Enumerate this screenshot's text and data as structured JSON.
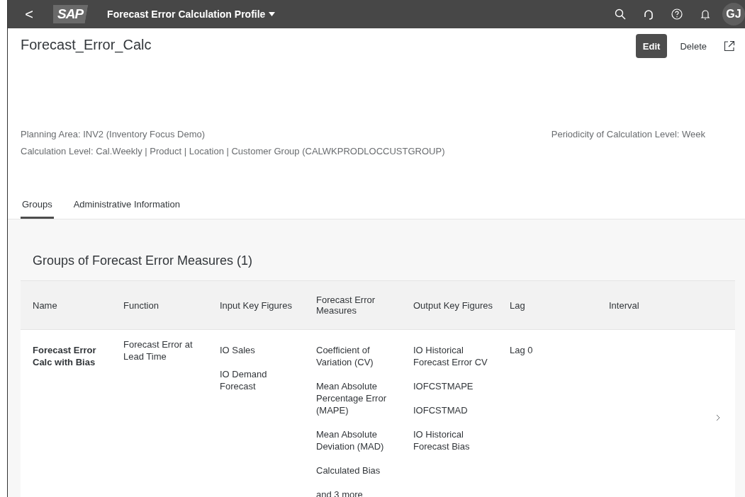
{
  "shell": {
    "back": "<",
    "logo": "SAP",
    "title": "Forecast Error Calculation Profile",
    "avatar": "GJ"
  },
  "header": {
    "title": "Forecast_Error_Calc",
    "actions": [
      {
        "label": "Edit",
        "kind": "primary"
      },
      {
        "label": "Delete",
        "kind": "plain"
      }
    ],
    "attributes": [
      "Planning Area: INV2 (Inventory Focus Demo)",
      "Calculation Level: Cal.Weekly | Product | Location | Customer Group (CALWKPRODLOCCUSTGROUP)"
    ],
    "side_attribute": "Periodicity of Calculation Level: Week"
  },
  "tabs": [
    {
      "label": "Groups",
      "selected": true
    },
    {
      "label": "Administrative Information",
      "selected": false
    }
  ],
  "section": {
    "title": "Groups of Forecast Error Measures (1)",
    "table": {
      "columns": [
        "Name",
        "Function",
        "Input Key Figures",
        "Forecast Error Measures",
        "Output Key Figures",
        "Lag",
        "Interval"
      ],
      "rows": [
        {
          "cells": [
            [
              "Forecast Error Calc with Bias"
            ],
            [
              "Forecast Error at Lead Time"
            ],
            [
              "IO Sales",
              "IO Demand Forecast"
            ],
            [
              "Coefficient of Variation (CV)",
              "Mean Absolute Percentage Error (MAPE)",
              "Mean Absolute Deviation (MAD)",
              "Calculated Bias",
              "and 3 more"
            ],
            [
              "IO Historical Forecast Error CV",
              "IOFCSTMAPE",
              "IOFCSTMAD",
              "IO Historical Forecast Bias"
            ],
            [
              "Lag 0"
            ],
            []
          ]
        }
      ]
    }
  }
}
